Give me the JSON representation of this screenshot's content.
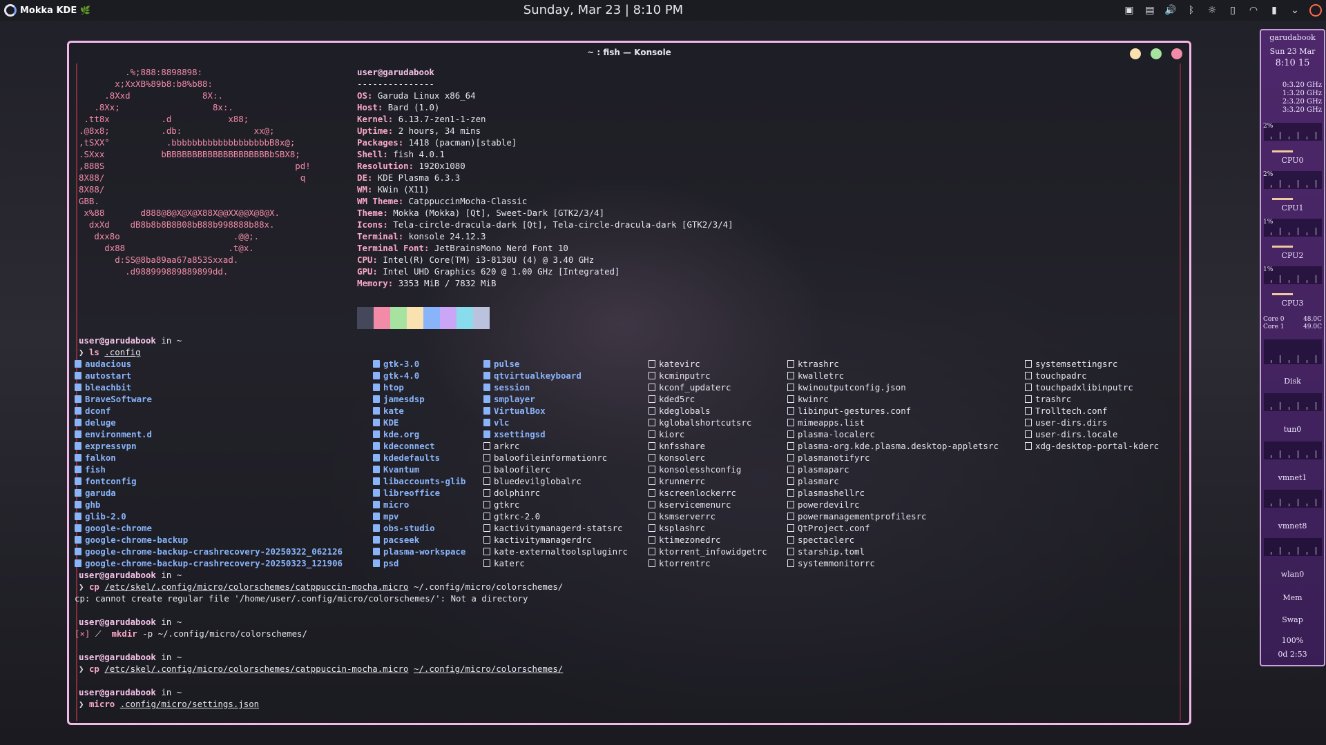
{
  "panel": {
    "launcher_label": "Mokka KDE",
    "clock": "Sunday, Mar 23 | 8:10 PM",
    "tray_icons": [
      "clipboard-icon",
      "calendar-icon",
      "volume-icon",
      "bluetooth-icon",
      "brightness-icon",
      "phone-icon",
      "wifi-icon",
      "battery-icon",
      "chevron-down-icon",
      "power-icon"
    ]
  },
  "window": {
    "title": "~ : fish — Konsole",
    "buttons": {
      "minimize_color": "#f9e2af",
      "maximize_color": "#a6e3a1",
      "close_color": "#f38ba8"
    },
    "border_color": "#f3b8ea"
  },
  "fetch": {
    "header": "user@garudabook",
    "rule": "---------------",
    "art": [
      "         .%;888:8898898:",
      "       x;XxXB%89b8:b8%b88:",
      "     .8Xxd              8X:.",
      "   .8Xx;                  8x:.",
      " .tt8x          .d           x88;",
      ".@8x8;          .db:              xx@;",
      ",tSXX°           .bbbbbbbbbbbbbbbbbbbB8x@;",
      ".SXxx           bBBBBBBBBBBBBBBBBBBBBbSBX8;",
      ",888S                                     pd!",
      "8X88/                                      q",
      "8X88/",
      "GBB.",
      " x%88       d888@8@X@X@X88X@@XX@@X@8@X.",
      "  dxXd    dB8b8b8B8B08bB88b998888b88x.",
      "   dxx8o                      .@@;.",
      "     dx88                    .t@x.",
      "       d:SS@8ba89aa67a853Sxxad.",
      "         .d988999889889899dd."
    ],
    "info": [
      {
        "key": "OS",
        "value": "Garuda Linux x86_64"
      },
      {
        "key": "Host",
        "value": "Bard (1.0)"
      },
      {
        "key": "Kernel",
        "value": "6.13.7-zen1-1-zen"
      },
      {
        "key": "Uptime",
        "value": "2 hours, 34 mins"
      },
      {
        "key": "Packages",
        "value": "1418 (pacman)[stable]"
      },
      {
        "key": "Shell",
        "value": "fish 4.0.1"
      },
      {
        "key": "Resolution",
        "value": "1920x1080"
      },
      {
        "key": "DE",
        "value": "KDE Plasma 6.3.3"
      },
      {
        "key": "WM",
        "value": "KWin (X11)"
      },
      {
        "key": "WM Theme",
        "value": "CatppuccinMocha-Classic"
      },
      {
        "key": "Theme",
        "value": "Mokka (Mokka) [Qt], Sweet-Dark [GTK2/3/4]"
      },
      {
        "key": "Icons",
        "value": "Tela-circle-dracula-dark [Qt], Tela-circle-dracula-dark [GTK2/3/4]"
      },
      {
        "key": "Terminal",
        "value": "konsole 24.12.3"
      },
      {
        "key": "Terminal Font",
        "value": "JetBrainsMono Nerd Font 10"
      },
      {
        "key": "CPU",
        "value": "Intel(R) Core(TM) i3-8130U (4) @ 3.40 GHz"
      },
      {
        "key": "GPU",
        "value": "Intel UHD Graphics 620 @ 1.00 GHz [Integrated]"
      },
      {
        "key": "Memory",
        "value": "3353 MiB / 7832 MiB"
      }
    ],
    "palette": [
      "#45475a",
      "#f38ba8",
      "#a6e3a1",
      "#f9e2af",
      "#89b4fa",
      "#cba6f7",
      "#89dceb",
      "#bac2de"
    ]
  },
  "prompt": {
    "user": "user@garudabook",
    "in": "in ~",
    "arrow": "❯"
  },
  "ls_command": {
    "cmd": "ls",
    "arg": ".config"
  },
  "listing": {
    "col1": [
      {
        "n": "audacious",
        "t": "d"
      },
      {
        "n": "autostart",
        "t": "d"
      },
      {
        "n": "bleachbit",
        "t": "d"
      },
      {
        "n": "BraveSoftware",
        "t": "d"
      },
      {
        "n": "dconf",
        "t": "d"
      },
      {
        "n": "deluge",
        "t": "d"
      },
      {
        "n": "environment.d",
        "t": "d"
      },
      {
        "n": "expressvpn",
        "t": "d"
      },
      {
        "n": "falkon",
        "t": "d"
      },
      {
        "n": "fish",
        "t": "d"
      },
      {
        "n": "fontconfig",
        "t": "d"
      },
      {
        "n": "garuda",
        "t": "d"
      },
      {
        "n": "ghb",
        "t": "d"
      },
      {
        "n": "glib-2.0",
        "t": "d"
      },
      {
        "n": "google-chrome",
        "t": "d"
      },
      {
        "n": "google-chrome-backup",
        "t": "d"
      },
      {
        "n": "google-chrome-backup-crashrecovery-20250322_062126",
        "t": "d"
      },
      {
        "n": "google-chrome-backup-crashrecovery-20250323_121906",
        "t": "d"
      }
    ],
    "col2": [
      {
        "n": "gtk-3.0",
        "t": "d"
      },
      {
        "n": "gtk-4.0",
        "t": "d"
      },
      {
        "n": "htop",
        "t": "d"
      },
      {
        "n": "jamesdsp",
        "t": "d"
      },
      {
        "n": "kate",
        "t": "d"
      },
      {
        "n": "KDE",
        "t": "d"
      },
      {
        "n": "kde.org",
        "t": "d"
      },
      {
        "n": "kdeconnect",
        "t": "d"
      },
      {
        "n": "kdedefaults",
        "t": "d"
      },
      {
        "n": "Kvantum",
        "t": "d"
      },
      {
        "n": "libaccounts-glib",
        "t": "d"
      },
      {
        "n": "libreoffice",
        "t": "d"
      },
      {
        "n": "micro",
        "t": "d"
      },
      {
        "n": "mpv",
        "t": "d"
      },
      {
        "n": "obs-studio",
        "t": "d"
      },
      {
        "n": "pacseek",
        "t": "d"
      },
      {
        "n": "plasma-workspace",
        "t": "d"
      },
      {
        "n": "psd",
        "t": "d"
      }
    ],
    "col3": [
      {
        "n": "pulse",
        "t": "d"
      },
      {
        "n": "qtvirtualkeyboard",
        "t": "d"
      },
      {
        "n": "session",
        "t": "d"
      },
      {
        "n": "smplayer",
        "t": "d"
      },
      {
        "n": "VirtualBox",
        "t": "d"
      },
      {
        "n": "vlc",
        "t": "d"
      },
      {
        "n": "xsettingsd",
        "t": "d"
      },
      {
        "n": "arkrc",
        "t": "f"
      },
      {
        "n": "baloofileinformationrc",
        "t": "f"
      },
      {
        "n": "baloofilerc",
        "t": "f"
      },
      {
        "n": "bluedevilglobalrc",
        "t": "f"
      },
      {
        "n": "dolphinrc",
        "t": "f"
      },
      {
        "n": "gtkrc",
        "t": "f"
      },
      {
        "n": "gtkrc-2.0",
        "t": "f"
      },
      {
        "n": "kactivitymanagerd-statsrc",
        "t": "f"
      },
      {
        "n": "kactivitymanagerdrc",
        "t": "f"
      },
      {
        "n": "kate-externaltoolspluginrc",
        "t": "f"
      },
      {
        "n": "katerc",
        "t": "f"
      }
    ],
    "col4": [
      {
        "n": "katevirc",
        "t": "f"
      },
      {
        "n": "kcminputrc",
        "t": "f"
      },
      {
        "n": "kconf_updaterc",
        "t": "f"
      },
      {
        "n": "kded5rc",
        "t": "f"
      },
      {
        "n": "kdeglobals",
        "t": "f"
      },
      {
        "n": "kglobalshortcutsrc",
        "t": "f"
      },
      {
        "n": "kiorc",
        "t": "f"
      },
      {
        "n": "knfsshare",
        "t": "f"
      },
      {
        "n": "konsolerc",
        "t": "f"
      },
      {
        "n": "konsolesshconfig",
        "t": "f"
      },
      {
        "n": "krunnerrc",
        "t": "f"
      },
      {
        "n": "kscreenlockerrc",
        "t": "f"
      },
      {
        "n": "kservicemenurc",
        "t": "f"
      },
      {
        "n": "ksmserverrc",
        "t": "f"
      },
      {
        "n": "ksplashrc",
        "t": "f"
      },
      {
        "n": "ktimezonedrc",
        "t": "f"
      },
      {
        "n": "ktorrent_infowidgetrc",
        "t": "f"
      },
      {
        "n": "ktorrentrc",
        "t": "f"
      }
    ],
    "col5": [
      {
        "n": "ktrashrc",
        "t": "f"
      },
      {
        "n": "kwalletrc",
        "t": "f"
      },
      {
        "n": "kwinoutputconfig.json",
        "t": "f"
      },
      {
        "n": "kwinrc",
        "t": "f"
      },
      {
        "n": "libinput-gestures.conf",
        "t": "f"
      },
      {
        "n": "mimeapps.list",
        "t": "f"
      },
      {
        "n": "plasma-localerc",
        "t": "f"
      },
      {
        "n": "plasma-org.kde.plasma.desktop-appletsrc",
        "t": "f"
      },
      {
        "n": "plasmanotifyrc",
        "t": "f"
      },
      {
        "n": "plasmaparc",
        "t": "f"
      },
      {
        "n": "plasmarc",
        "t": "f"
      },
      {
        "n": "plasmashellrc",
        "t": "f"
      },
      {
        "n": "powerdevilrc",
        "t": "f"
      },
      {
        "n": "powermanagementprofilesrc",
        "t": "f"
      },
      {
        "n": "QtProject.conf",
        "t": "f"
      },
      {
        "n": "spectaclerc",
        "t": "f"
      },
      {
        "n": "starship.toml",
        "t": "f"
      },
      {
        "n": "systemmonitorrc",
        "t": "f"
      }
    ],
    "col6": [
      {
        "n": "systemsettingsrc",
        "t": "f"
      },
      {
        "n": "touchpadrc",
        "t": "f"
      },
      {
        "n": "touchpadxlibinputrc",
        "t": "f"
      },
      {
        "n": "trashrc",
        "t": "f"
      },
      {
        "n": "Trolltech.conf",
        "t": "f"
      },
      {
        "n": "user-dirs.dirs",
        "t": "f"
      },
      {
        "n": "user-dirs.locale",
        "t": "f"
      },
      {
        "n": "xdg-desktop-portal-kderc",
        "t": "f"
      }
    ]
  },
  "history": {
    "cp1": {
      "cmd": "cp",
      "src": "/etc/skel/.config/micro/colorschemes/catppuccin-mocha.micro",
      "dst": "~/.config/micro/colorschemes/"
    },
    "cp1_error": "cp: cannot create regular file '/home/user/.config/micro/colorschemes/': Not a directory",
    "mkdir": {
      "status": "[×]",
      "cmd": "mkdir",
      "args": "-p ~/.config/micro/colorschemes/"
    },
    "cp2": {
      "cmd": "cp",
      "src": "/etc/skel/.config/micro/colorschemes/catppuccin-mocha.micro",
      "dst": "~/.config/micro/colorschemes/"
    },
    "micro": {
      "cmd": "micro",
      "arg": ".config/micro/settings.json"
    }
  },
  "conky": {
    "host": "garudabook",
    "date": "Sun 23 Mar",
    "time": "8:10 15",
    "freqs": [
      "0:3.20 GHz",
      "1:3.20 GHz",
      "2:3.20 GHz",
      "3:3.20 GHz"
    ],
    "cpus": [
      {
        "label": "CPU0",
        "pct": "2%"
      },
      {
        "label": "CPU1",
        "pct": "2%"
      },
      {
        "label": "CPU2",
        "pct": "1%"
      },
      {
        "label": "CPU3",
        "pct": "1%"
      }
    ],
    "temps": [
      {
        "label": "Core 0",
        "value": "48.0C"
      },
      {
        "label": "Core 1",
        "value": "49.0C"
      }
    ],
    "disk_label": "Disk",
    "nets": [
      "tun0",
      "vmnet1",
      "vmnet8",
      "wlan0"
    ],
    "mem_label": "Mem",
    "swap_label": "Swap",
    "battery": "100%",
    "uptime": "0d 2:53"
  }
}
